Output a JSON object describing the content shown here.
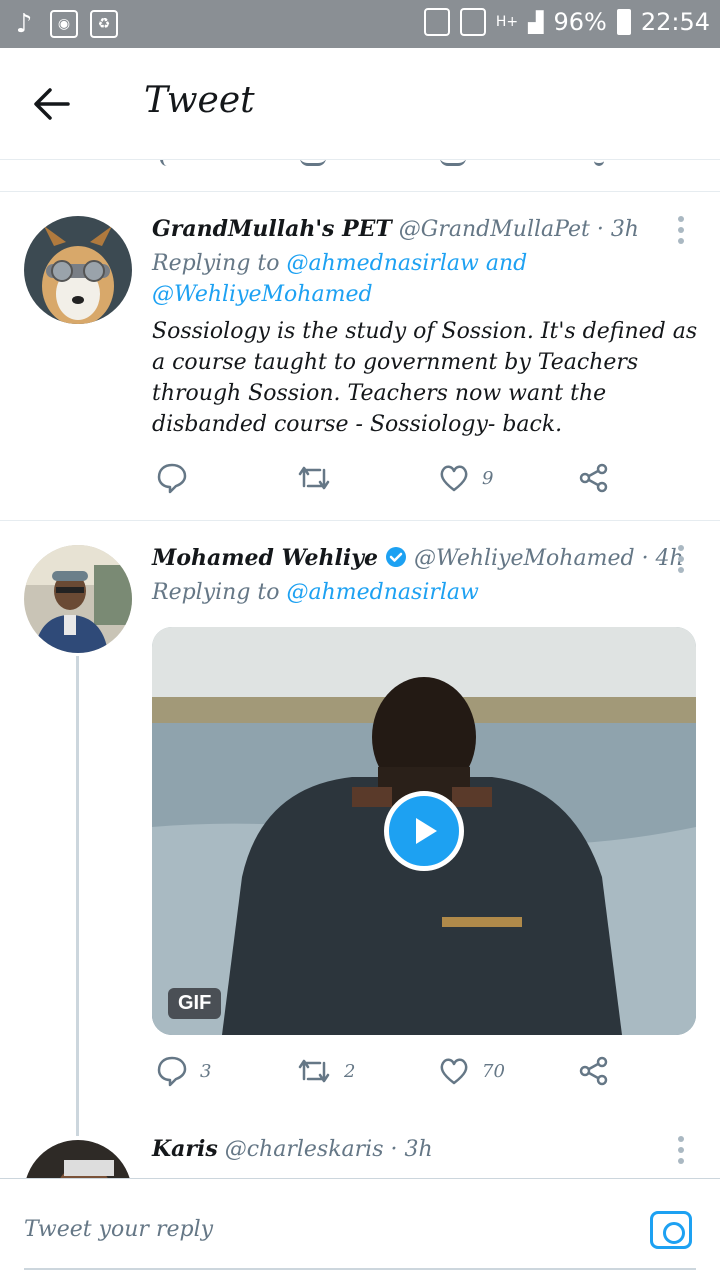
{
  "status_bar": {
    "battery": "96%",
    "time": "22:54"
  },
  "header": {
    "title": "Tweet"
  },
  "tweets": [
    {
      "name": "GrandMullah's PET",
      "handle": "@GrandMullaPet",
      "time": "· 3h",
      "replying_to_label": "Replying to",
      "replying_to": "@ahmednasirlaw and @WehliyeMohamed",
      "text": "Sossiology is the study of Sossion. It's defined as a course taught to government by Teachers through Sossion. Teachers now want the disbanded course - Sossiology- back.",
      "likes": "9"
    },
    {
      "name": "Mohamed Wehliye",
      "handle": "@WehliyeMohamed",
      "time": "· 4h",
      "replying_to_label": "Replying to",
      "replying_to": "@ahmednasirlaw",
      "media_badge": "GIF",
      "replies": "3",
      "retweets": "2",
      "likes": "70"
    },
    {
      "name": "Karis",
      "handle": "@charleskaris",
      "time": "· 3h"
    }
  ],
  "composer": {
    "placeholder": "Tweet your reply"
  },
  "colors": {
    "accent": "#1da1f2",
    "verified": "#1da1f2"
  }
}
